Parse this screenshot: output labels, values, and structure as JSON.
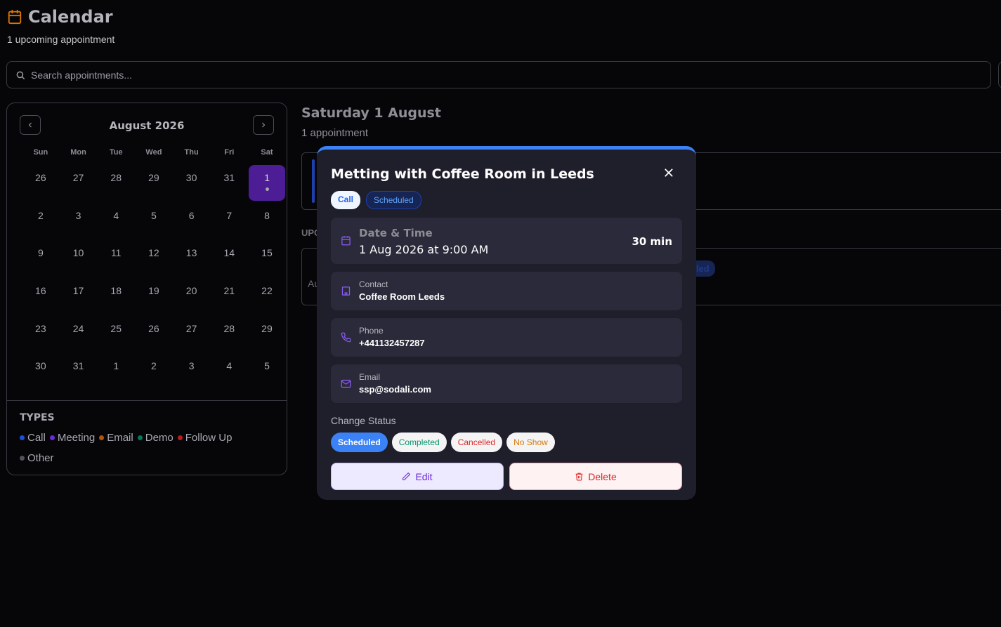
{
  "header": {
    "title": "Calendar",
    "subtitle": "1 upcoming appointment"
  },
  "search": {
    "placeholder": "Search appointments..."
  },
  "calendar": {
    "month_label": "August 2026",
    "weekdays": [
      "Sun",
      "Mon",
      "Tue",
      "Wed",
      "Thu",
      "Fri",
      "Sat"
    ],
    "days": [
      "26",
      "27",
      "28",
      "29",
      "30",
      "31",
      "1",
      "2",
      "3",
      "4",
      "5",
      "6",
      "7",
      "8",
      "9",
      "10",
      "11",
      "12",
      "13",
      "14",
      "15",
      "16",
      "17",
      "18",
      "19",
      "20",
      "21",
      "22",
      "23",
      "24",
      "25",
      "26",
      "27",
      "28",
      "29",
      "30",
      "31",
      "1",
      "2",
      "3",
      "4",
      "5"
    ],
    "selected_index": 6
  },
  "types": {
    "heading": "TYPES",
    "items": [
      {
        "label": "Call",
        "color": "#1d4ed8"
      },
      {
        "label": "Meeting",
        "color": "#6d28d9"
      },
      {
        "label": "Email",
        "color": "#b45309"
      },
      {
        "label": "Demo",
        "color": "#047857"
      },
      {
        "label": "Follow Up",
        "color": "#b91c1c"
      },
      {
        "label": "Other",
        "color": "#52525b"
      }
    ]
  },
  "day_view": {
    "title": "Saturday 1 August",
    "count": "1 appointment",
    "upcoming_label": "UPC",
    "upcoming_date": "Au",
    "upcoming_badge": "uled"
  },
  "modal": {
    "title": "Metting with Coffee Room in Leeds",
    "type_badge": "Call",
    "status_badge": "Scheduled",
    "datetime_label": "Date & Time",
    "datetime_value": "1 Aug 2026 at 9:00 AM",
    "duration": "30 min",
    "contact_label": "Contact",
    "contact_value": "Coffee Room Leeds",
    "phone_label": "Phone",
    "phone_value": "+441132457287",
    "email_label": "Email",
    "email_value": "ssp@sodali.com",
    "change_status_label": "Change Status",
    "statuses": [
      "Scheduled",
      "Completed",
      "Cancelled",
      "No Show"
    ],
    "edit_label": "Edit",
    "delete_label": "Delete"
  },
  "colors": {
    "accent": "#3b82f6",
    "selected_day": "#4c1d95",
    "icon_purple": "#8b5cf6",
    "header_icon": "#d97706"
  }
}
